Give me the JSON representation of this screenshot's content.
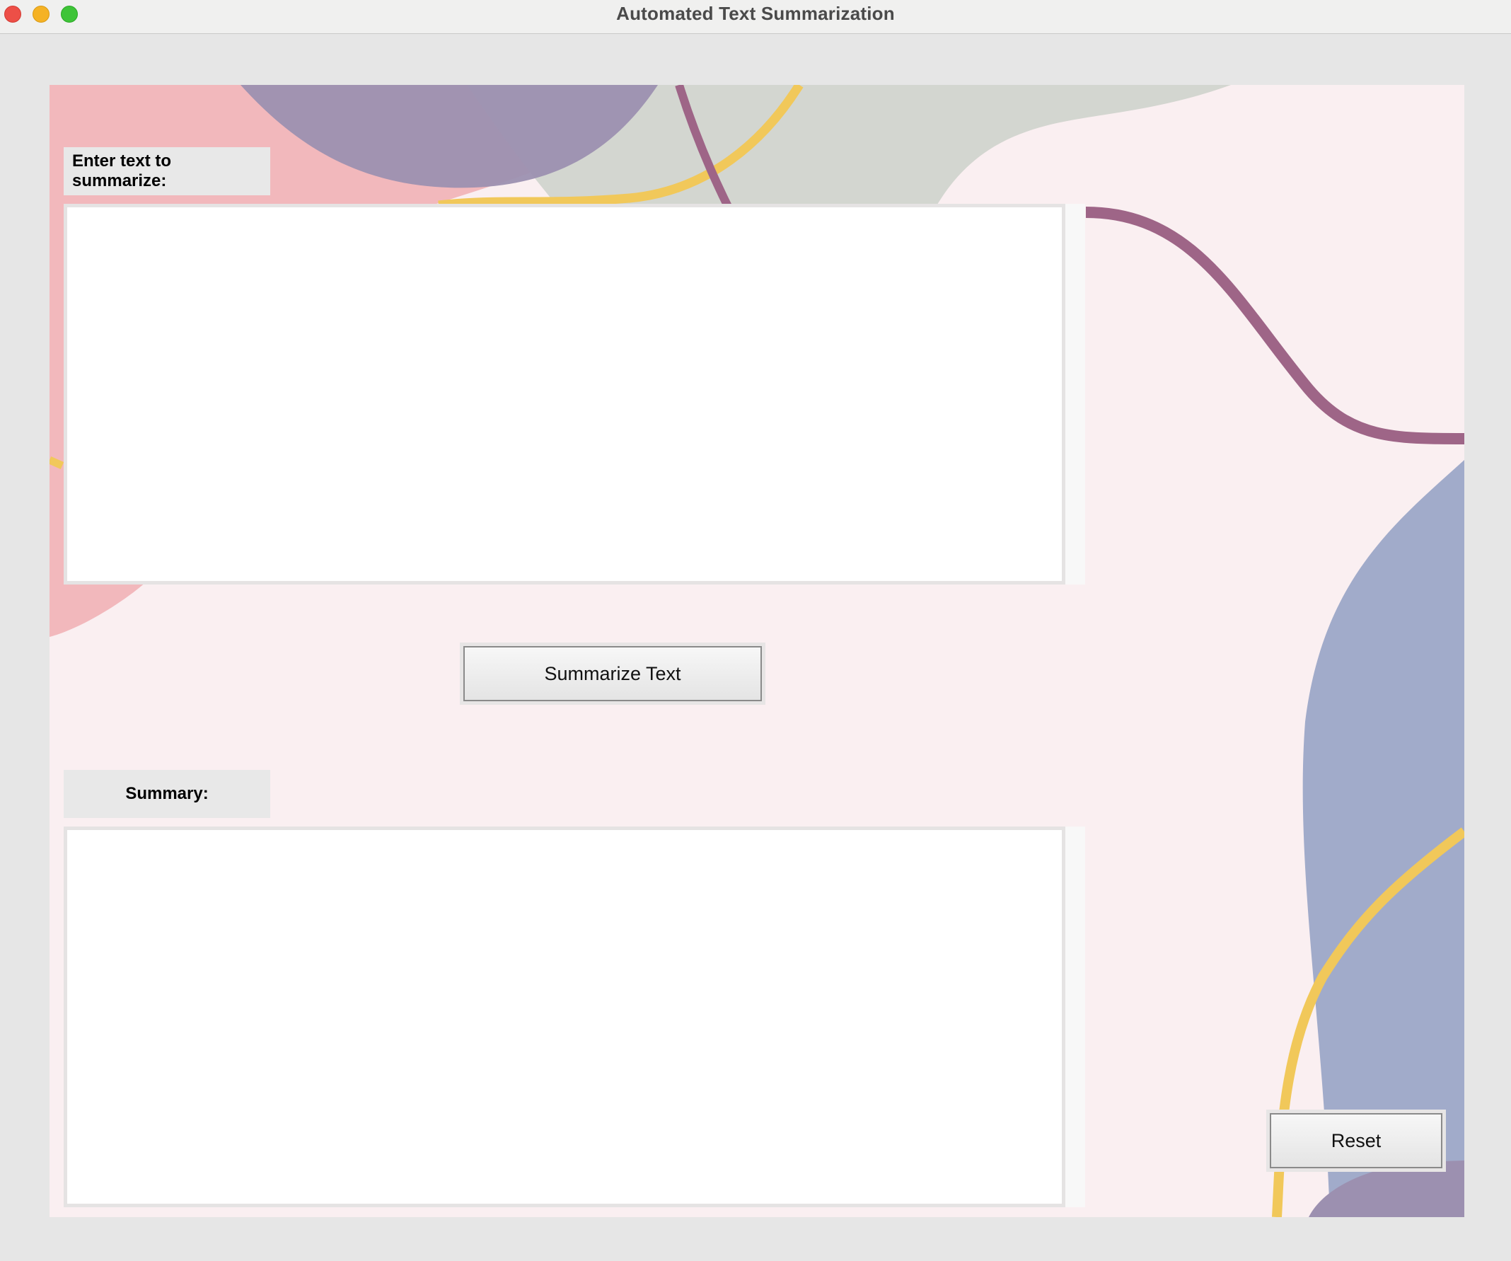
{
  "window": {
    "title": "Automated Text Summarization",
    "controls": [
      "close",
      "minimize",
      "maximize"
    ]
  },
  "input": {
    "label": "Enter text to summarize:",
    "value": "",
    "placeholder": ""
  },
  "actions": {
    "summarize_label": "Summarize Text",
    "reset_label": "Reset"
  },
  "output": {
    "label": "Summary:",
    "value": ""
  },
  "colors": {
    "window_bg": "#e6e6e6",
    "canvas_bg": "#faeff1",
    "blob_pink": "#f2b8bc",
    "blob_purple": "#9c90b0",
    "blob_gray": "#d3d6d0",
    "blob_blue": "#a1abca",
    "line_yellow": "#f1c85a",
    "line_plum": "#9e6587",
    "label_bg": "#e8e8e8"
  }
}
